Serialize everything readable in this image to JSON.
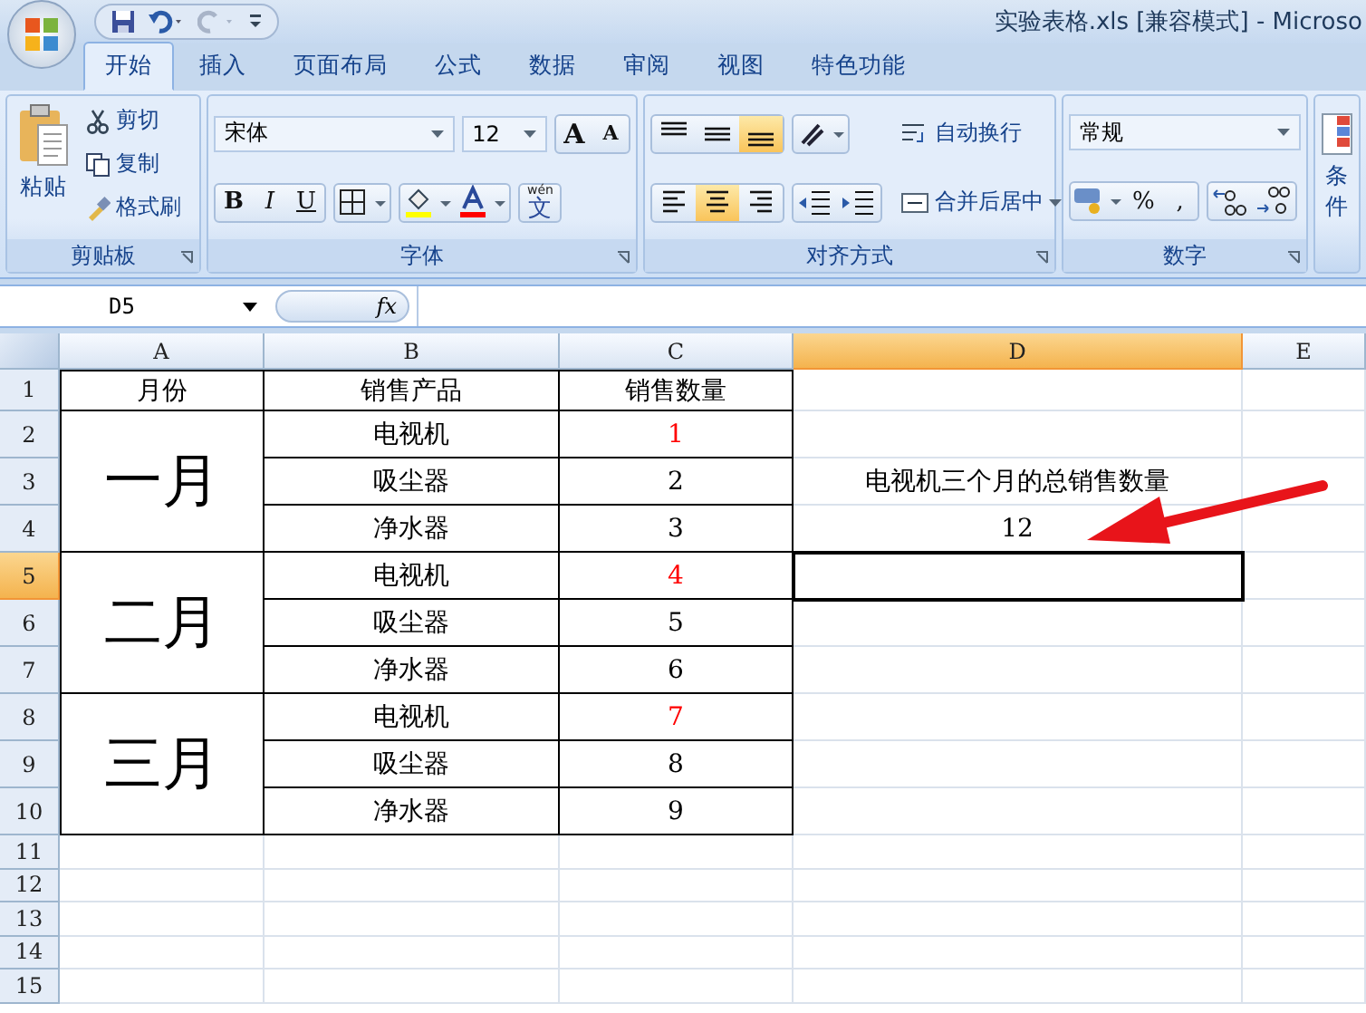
{
  "title_bar": {
    "title": "实验表格.xls  [兼容模式] - Microso"
  },
  "ribbon_tabs": [
    {
      "label": "开始",
      "selected": true
    },
    {
      "label": "插入",
      "selected": false
    },
    {
      "label": "页面布局",
      "selected": false
    },
    {
      "label": "公式",
      "selected": false
    },
    {
      "label": "数据",
      "selected": false
    },
    {
      "label": "审阅",
      "selected": false
    },
    {
      "label": "视图",
      "selected": false
    },
    {
      "label": "特色功能",
      "selected": false
    }
  ],
  "ribbon": {
    "clipboard": {
      "label": "剪贴板",
      "paste": "粘贴",
      "cut": "剪切",
      "copy": "复制",
      "format_painter": "格式刷"
    },
    "font": {
      "label": "字体",
      "font_name": "宋体",
      "font_size": "12",
      "grow": "A",
      "shrink": "A",
      "bold": "B",
      "italic": "I",
      "underline": "U",
      "phonetic_top": "wén",
      "phonetic": "文"
    },
    "alignment": {
      "label": "对齐方式",
      "vertical": [
        {
          "kind": "top",
          "selected": false
        },
        {
          "kind": "middle",
          "selected": false
        },
        {
          "kind": "bottom",
          "selected": true
        }
      ],
      "horizontal": [
        {
          "kind": "left",
          "selected": false
        },
        {
          "kind": "center",
          "selected": true
        },
        {
          "kind": "right",
          "selected": false
        }
      ],
      "wrap_text": "自动换行",
      "merge_center": "合并后居中"
    },
    "number": {
      "label": "数字",
      "format": "常规",
      "percent": "%",
      "comma": ","
    },
    "styles": {
      "label": "条件"
    }
  },
  "formula_bar": {
    "name_box": "D5",
    "function_label": "fx"
  },
  "columns": [
    {
      "label": "A",
      "selected": false
    },
    {
      "label": "B",
      "selected": false
    },
    {
      "label": "C",
      "selected": false
    },
    {
      "label": "D",
      "selected": true
    },
    {
      "label": "E",
      "selected": false
    }
  ],
  "row_headers": [
    {
      "label": "1",
      "selected": false
    },
    {
      "label": "2",
      "selected": false
    },
    {
      "label": "3",
      "selected": false
    },
    {
      "label": "4",
      "selected": false
    },
    {
      "label": "5",
      "selected": true
    },
    {
      "label": "6",
      "selected": false
    },
    {
      "label": "7",
      "selected": false
    },
    {
      "label": "8",
      "selected": false
    },
    {
      "label": "9",
      "selected": false
    },
    {
      "label": "10",
      "selected": false
    },
    {
      "label": "11",
      "selected": false
    },
    {
      "label": "12",
      "selected": false
    },
    {
      "label": "13",
      "selected": false
    },
    {
      "label": "14",
      "selected": false
    },
    {
      "label": "15",
      "selected": false
    }
  ],
  "header_cells": [
    "月份",
    "销售产品",
    "销售数量"
  ],
  "groups": [
    {
      "month": "一月",
      "items": [
        {
          "product": "电视机",
          "quantity": "1",
          "color": "#ff0000"
        },
        {
          "product": "吸尘器",
          "quantity": "2",
          "color": "#000000"
        },
        {
          "product": "净水器",
          "quantity": "3",
          "color": "#000000"
        }
      ]
    },
    {
      "month": "二月",
      "items": [
        {
          "product": "电视机",
          "quantity": "4",
          "color": "#ff0000"
        },
        {
          "product": "吸尘器",
          "quantity": "5",
          "color": "#000000"
        },
        {
          "product": "净水器",
          "quantity": "6",
          "color": "#000000"
        }
      ]
    },
    {
      "month": "三月",
      "items": [
        {
          "product": "电视机",
          "quantity": "7",
          "color": "#ff0000"
        },
        {
          "product": "吸尘器",
          "quantity": "8",
          "color": "#000000"
        },
        {
          "product": "净水器",
          "quantity": "9",
          "color": "#000000"
        }
      ]
    }
  ],
  "note": {
    "text": "电视机三个月的总销售数量",
    "total": "12"
  }
}
